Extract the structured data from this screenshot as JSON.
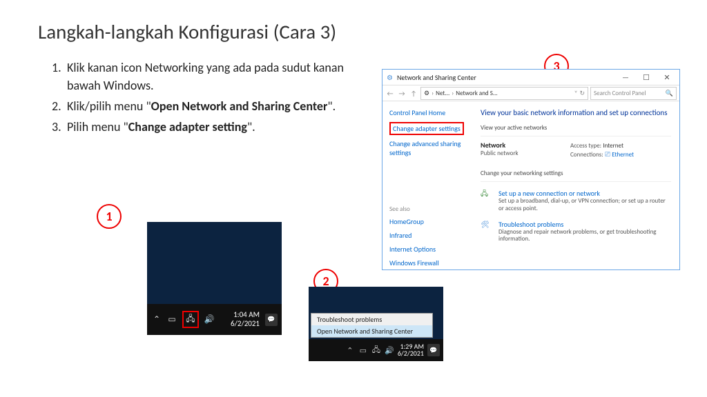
{
  "title": "Langkah-langkah Konfigurasi (Cara 3)",
  "steps": [
    {
      "n": "1.",
      "text": "Klik kanan icon Networking yang ada pada sudut kanan bawah Windows."
    },
    {
      "n": "2.",
      "text_pre": "Klik/pilih menu \"",
      "text_bold": "Open Network and Sharing Center",
      "text_post": "\"."
    },
    {
      "n": "3.",
      "text_pre": "Pilih menu \"",
      "text_bold": "Change adapter setting",
      "text_post": "\"."
    }
  ],
  "badges": {
    "b1": "1",
    "b2": "2",
    "b3": "3"
  },
  "shot1": {
    "time": "1:04 AM",
    "date": "6/2/2021"
  },
  "shot2": {
    "menu": {
      "item1": "Troubleshoot problems",
      "item2": "Open Network and Sharing Center"
    },
    "time": "1:29 AM",
    "date": "6/2/2021"
  },
  "shot3": {
    "window_title": "Network and Sharing Center",
    "breadcrumb": {
      "p1": "Net...",
      "p2": "Network and S..."
    },
    "search_placeholder": "Search Control Panel",
    "side": {
      "home": "Control Panel Home",
      "change_adapter": "Change adapter settings",
      "change_advanced": "Change advanced sharing settings",
      "see_also": "See also",
      "homegroup": "HomeGroup",
      "infrared": "Infrared",
      "internet_options": "Internet Options",
      "firewall": "Windows Firewall"
    },
    "main": {
      "header": "View your basic network information and set up connections",
      "active_label": "View your active networks",
      "net_name": "Network",
      "net_type": "Public network",
      "access_label": "Access type:",
      "access_value": "Internet",
      "conn_label": "Connections:",
      "conn_value": "Ethernet",
      "change_label": "Change your networking settings",
      "opt1_title": "Set up a new connection or network",
      "opt1_desc": "Set up a broadband, dial-up, or VPN connection; or set up a router or access point.",
      "opt2_title": "Troubleshoot problems",
      "opt2_desc": "Diagnose and repair network problems, or get troubleshooting information."
    }
  }
}
